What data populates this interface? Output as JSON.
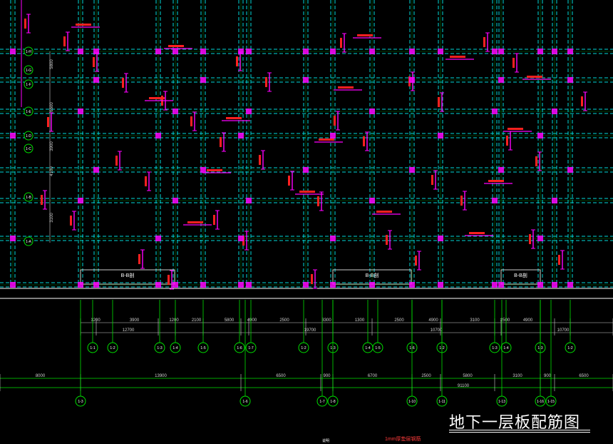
{
  "drawing_title": "地下一层板配筋图",
  "footer_note": "1mm厚垫层钢筋",
  "small_mark": "说明",
  "colors": {
    "background": "#000000",
    "axis_green": "#00e000",
    "beam_cyan": "#00d7d7",
    "column_magenta": "#ff00ff",
    "rebar_red": "#ff2020",
    "white": "#ffffff",
    "dim_white": "#cfcfcf"
  },
  "upper_dimensions": [
    "1200",
    "3900",
    "1200",
    "2100",
    "5800",
    "4900",
    "2500",
    "3300",
    "1300",
    "2500",
    "4900",
    "3100",
    "2500",
    "4900"
  ],
  "upper_totals": [
    "12700",
    "19700",
    "10700",
    "10700"
  ],
  "lower_dimensions": [
    "8000",
    "13900",
    "6500",
    "900",
    "6700",
    "2500",
    "5800",
    "3100",
    "900",
    "6500"
  ],
  "lower_total": "91100",
  "upper_axes": [
    "1-1",
    "1-2",
    "1-3",
    "1-4",
    "1-5",
    "1-6",
    "1-7",
    "1-2",
    "1-3",
    "1-4",
    "1-5",
    "1-6",
    "1-2",
    "1-3",
    "1-4",
    "1-3",
    "1-2"
  ],
  "lower_axes": [
    "1-3",
    "1-6",
    "1-7",
    "1-8",
    "1-10",
    "1-11",
    "1-13",
    "1-16",
    "1-15"
  ],
  "left_axes": [
    "1-H",
    "1-G",
    "1-F",
    "1-E",
    "1-D",
    "1-C",
    "1-B",
    "1-A"
  ],
  "left_dimensions": [
    "5800",
    "6500",
    "3900",
    "4100",
    "3100"
  ],
  "section_tags": [
    "B-B剖",
    "B-B剖",
    "B-B剖"
  ]
}
